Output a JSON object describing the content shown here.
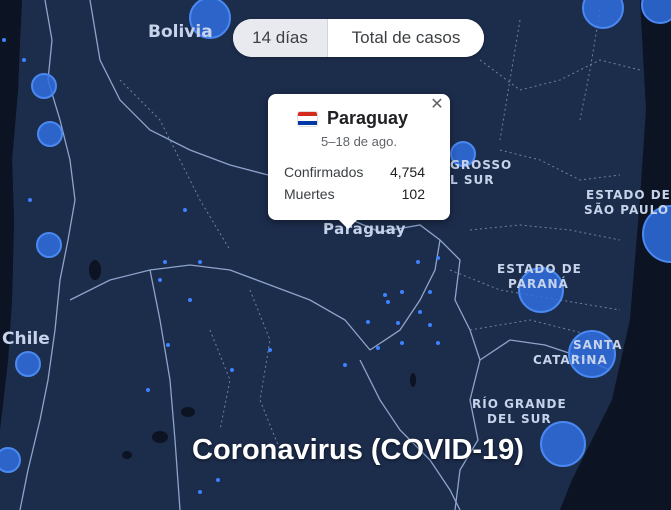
{
  "controls": {
    "period_label": "14 días",
    "total_label": "Total de casos"
  },
  "map": {
    "labels": {
      "bolivia": "Bolivia",
      "chile": "Chile",
      "paraguay": "Paraguay",
      "mato_grosso_1": "GROSSO",
      "mato_grosso_2": "L SUR",
      "sao_paulo_1": "ESTADO DE",
      "sao_paulo_2": "SÃO PAULO",
      "parana_1": "ESTADO DE",
      "parana_2": "PARANÁ",
      "santa_catarina_1": "SANTA",
      "santa_catarina_2": "CATARINA",
      "rio_grande_1": "RÍO GRANDE",
      "rio_grande_2": "DEL SUR"
    },
    "colors": {
      "land": "#1c2c4b",
      "ocean": "#0c1322",
      "border": "#8ea4cc",
      "marker": "#2f6fe0",
      "dot": "#3d82ff"
    }
  },
  "popup": {
    "country": "Paraguay",
    "date_range": "5–18 de ago.",
    "confirmed_label": "Confirmados",
    "confirmed_value": "4,754",
    "deaths_label": "Muertes",
    "deaths_value": "102",
    "close_icon": "close-icon",
    "flag_colors": [
      "#d52b1e",
      "#ffffff",
      "#0038a8"
    ]
  },
  "footer_title": "Coronavirus (COVID-19)"
}
